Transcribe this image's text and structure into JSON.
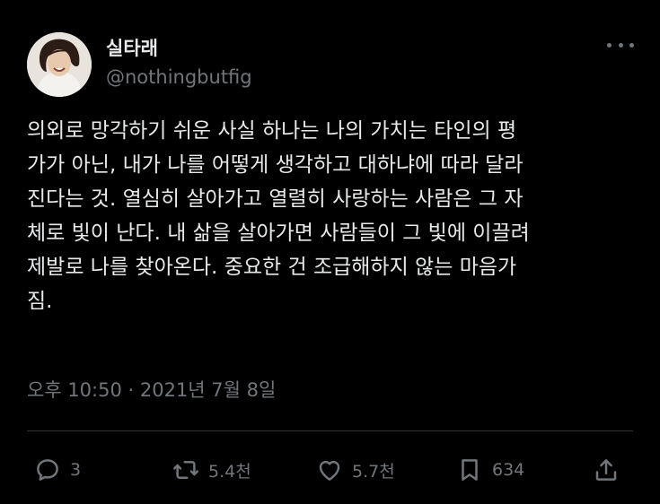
{
  "author": {
    "display_name": "실타래",
    "handle": "@nothingbutfig"
  },
  "tweet": {
    "text": "의외로 망각하기 쉬운 사실 하나는 나의 가치는 타인의 평\n가가 아닌, 내가 나를 어떻게 생각하고 대하냐에 따라 달라\n진다는 것. 열심히 살아가고 열렬히 사랑하는 사람은 그 자\n체로 빛이 난다. 내 삶을 살아가면 사람들이 그 빛에 이끌려\n제발로 나를 찾아온다. 중요한 건 조급해하지 않는 마음가\n짐.",
    "timestamp": "오후 10:50 · 2021년 7월 8일"
  },
  "actions": {
    "reply_count": "3",
    "retweet_count": "5.4천",
    "like_count": "5.7천",
    "bookmark_count": "634"
  },
  "icons": {
    "more": "more-horizontal-icon",
    "reply": "reply-bubble-icon",
    "retweet": "retweet-arrows-icon",
    "like": "heart-icon",
    "bookmark": "bookmark-icon",
    "share": "share-upload-icon"
  },
  "colors": {
    "background": "#000000",
    "text_primary": "#e7e9ea",
    "text_secondary": "#71767b",
    "divider": "#2f3336"
  }
}
